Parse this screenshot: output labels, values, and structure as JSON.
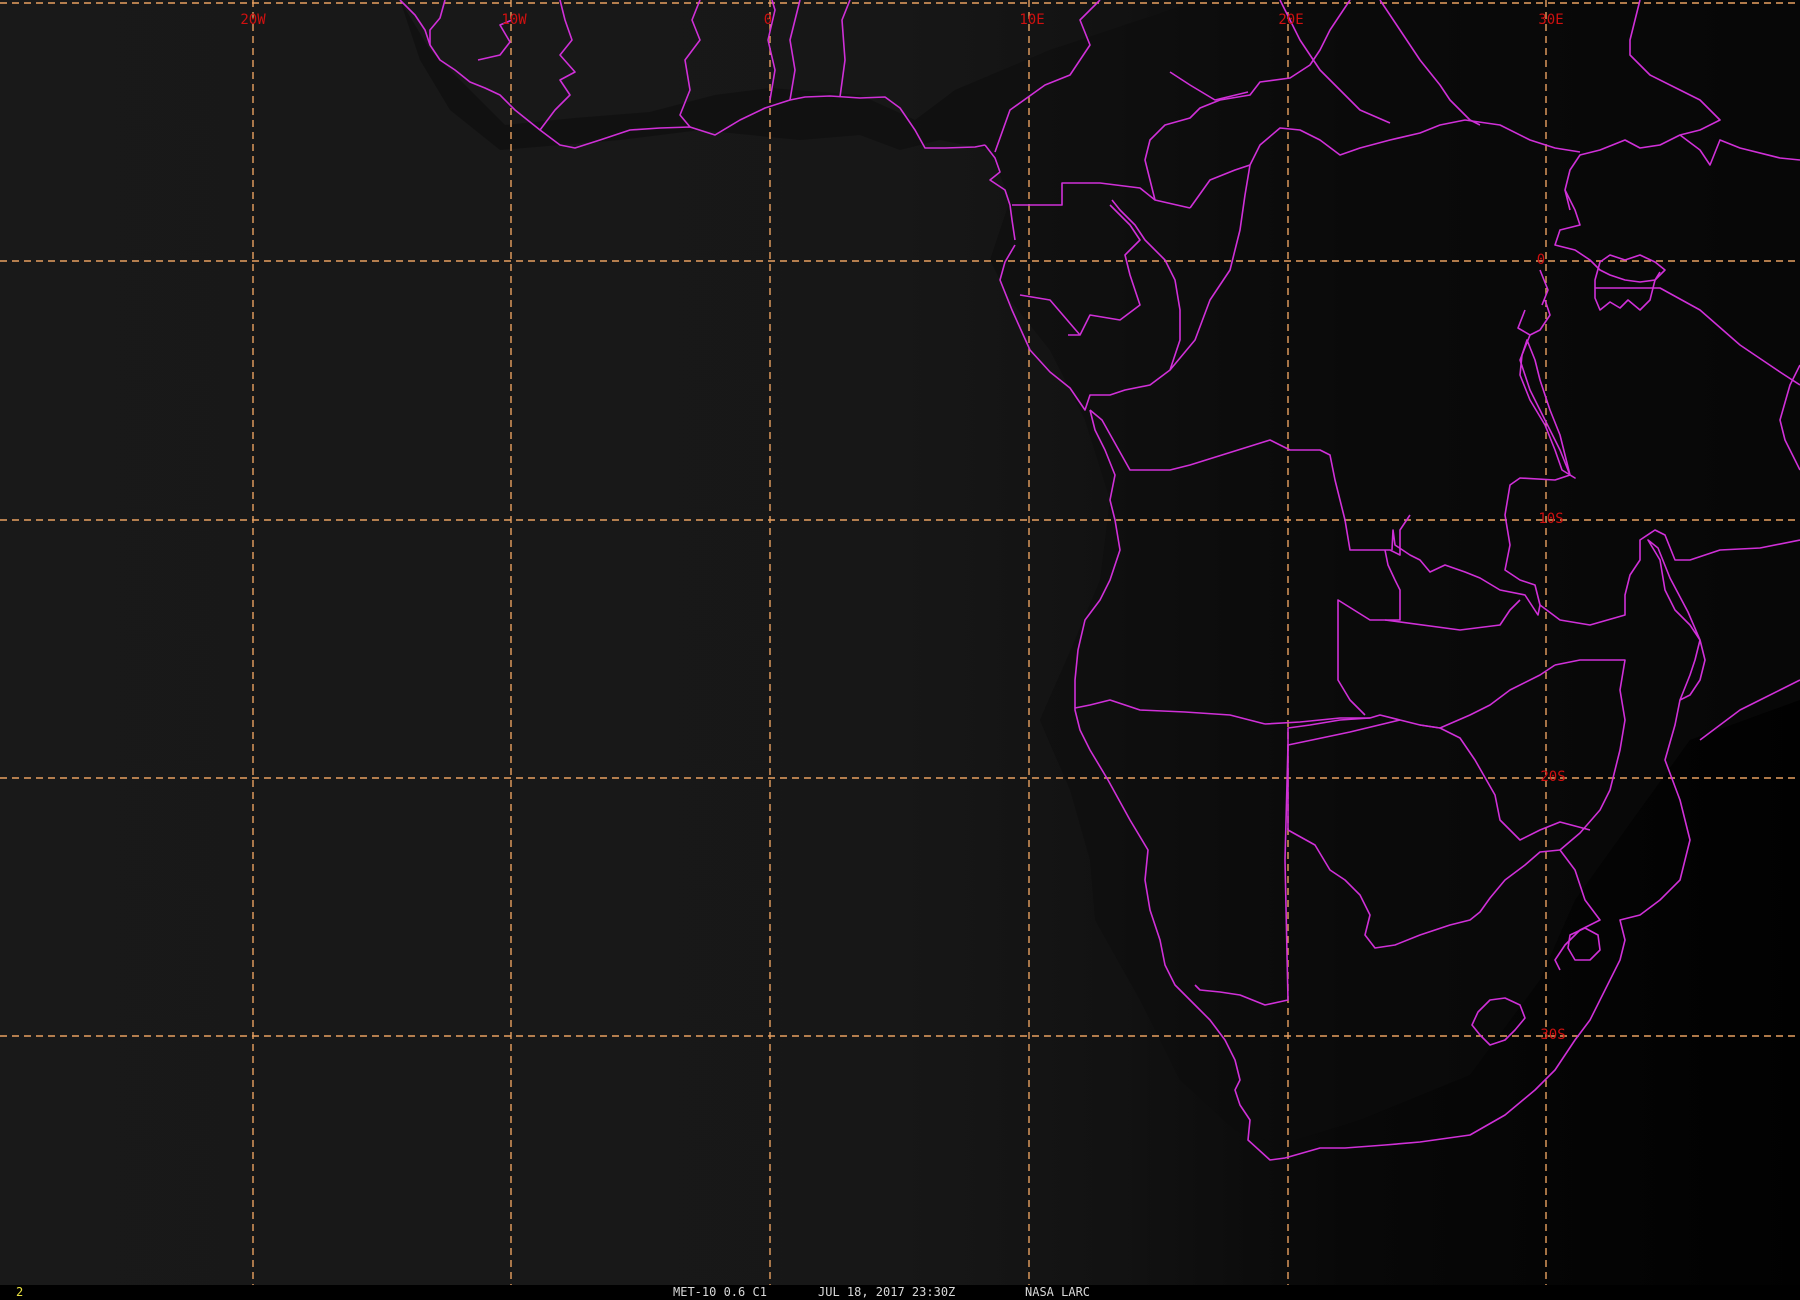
{
  "colors": {
    "ocean": "#171717",
    "land": "#0c0c0c",
    "borders": "#d030d8",
    "grid": "#e8a060",
    "grid_labels": "#d01010",
    "status_text": "#d8d8d8",
    "frame_number": "#e8e040"
  },
  "map": {
    "longitude_labels": [
      "20W",
      "10W",
      "0",
      "10E",
      "20E",
      "30E"
    ],
    "latitude_labels": [
      "0",
      "10S",
      "20S",
      "30S"
    ]
  },
  "status_bar": {
    "frame_number": "2",
    "product": "MET-10 0.6 C1",
    "datetime": "JUL 18, 2017 23:30Z",
    "source": "NASA LARC"
  }
}
